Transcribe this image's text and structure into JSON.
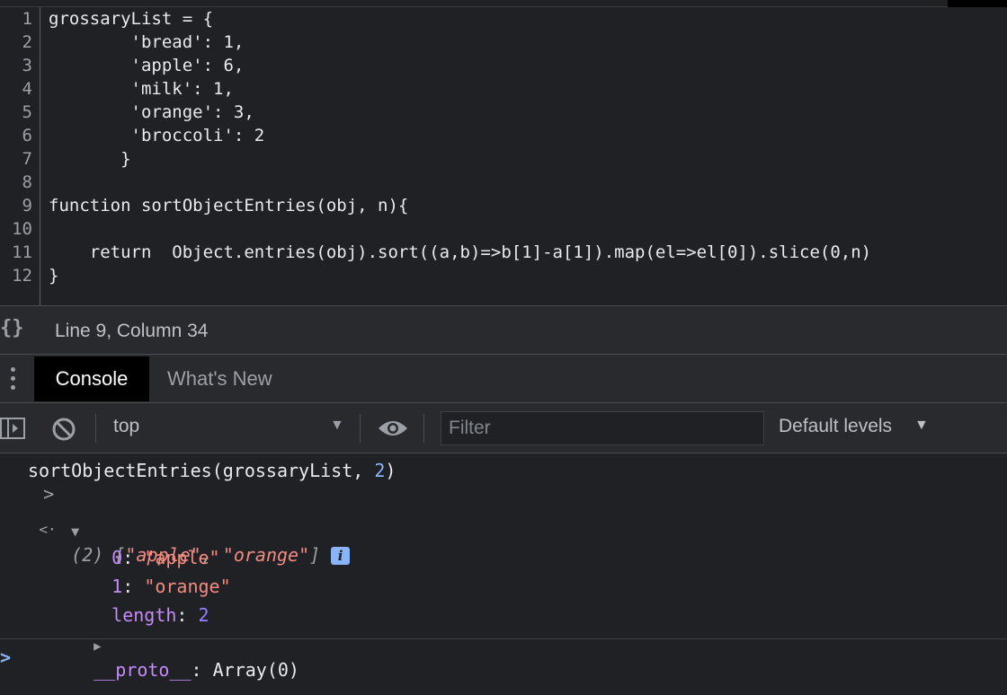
{
  "editor": {
    "line_numbers": [
      "1",
      "2",
      "3",
      "4",
      "5",
      "6",
      "7",
      "8",
      "9",
      "10",
      "11",
      "12"
    ],
    "lines": [
      "grossaryList = {",
      "        'bread': 1,",
      "        'apple': 6,",
      "        'milk': 1,",
      "        'orange': 3,",
      "        'broccoli': 2",
      "       }",
      "",
      "function sortObjectEntries(obj, n){",
      "",
      "    return  Object.entries(obj).sort((a,b)=>b[1]-a[1]).map(el=>el[0]).slice(0,n)",
      "}"
    ]
  },
  "status_bar": {
    "format_icon": "{}",
    "cursor_position": "Line 9, Column 34"
  },
  "drawer": {
    "menu_icon": "kebab-menu-icon",
    "tabs": [
      {
        "label": "Console",
        "active": true
      },
      {
        "label": "What's New",
        "active": false
      }
    ]
  },
  "console_toolbar": {
    "sidebar_icon": "show-sidebar-icon",
    "clear_icon": "clear-console-icon",
    "context": "top",
    "context_arrow": "▼",
    "eye_icon": "live-expression-eye-icon",
    "filter_placeholder": "Filter",
    "levels_label": "Default levels",
    "levels_arrow": "▼"
  },
  "console_output": {
    "input_prompt": ">",
    "input_fn": "sortObjectEntries(grossaryList, ",
    "input_arg": "2",
    "input_close": ")",
    "result_marker": "<·",
    "result_expand": "▼",
    "result_count": "(2) [",
    "result_item_1": "\"apple\"",
    "result_sep": ", ",
    "result_item_2": "\"orange\"",
    "result_close": "]",
    "info_badge": "i",
    "entries": [
      {
        "key": "0",
        "value": "\"apple\""
      },
      {
        "key": "1",
        "value": "\"orange\""
      }
    ],
    "length_key": "length",
    "length_value": "2",
    "proto_expand": "▶",
    "proto_key": "__proto__",
    "proto_value": "Array(0)",
    "prompt": ">"
  },
  "colors": {
    "background": "#202124",
    "panel": "#292a2d",
    "string": "#f28b82",
    "key": "#c58af9",
    "number": "#9980ff",
    "accent": "#8ab4f8"
  }
}
